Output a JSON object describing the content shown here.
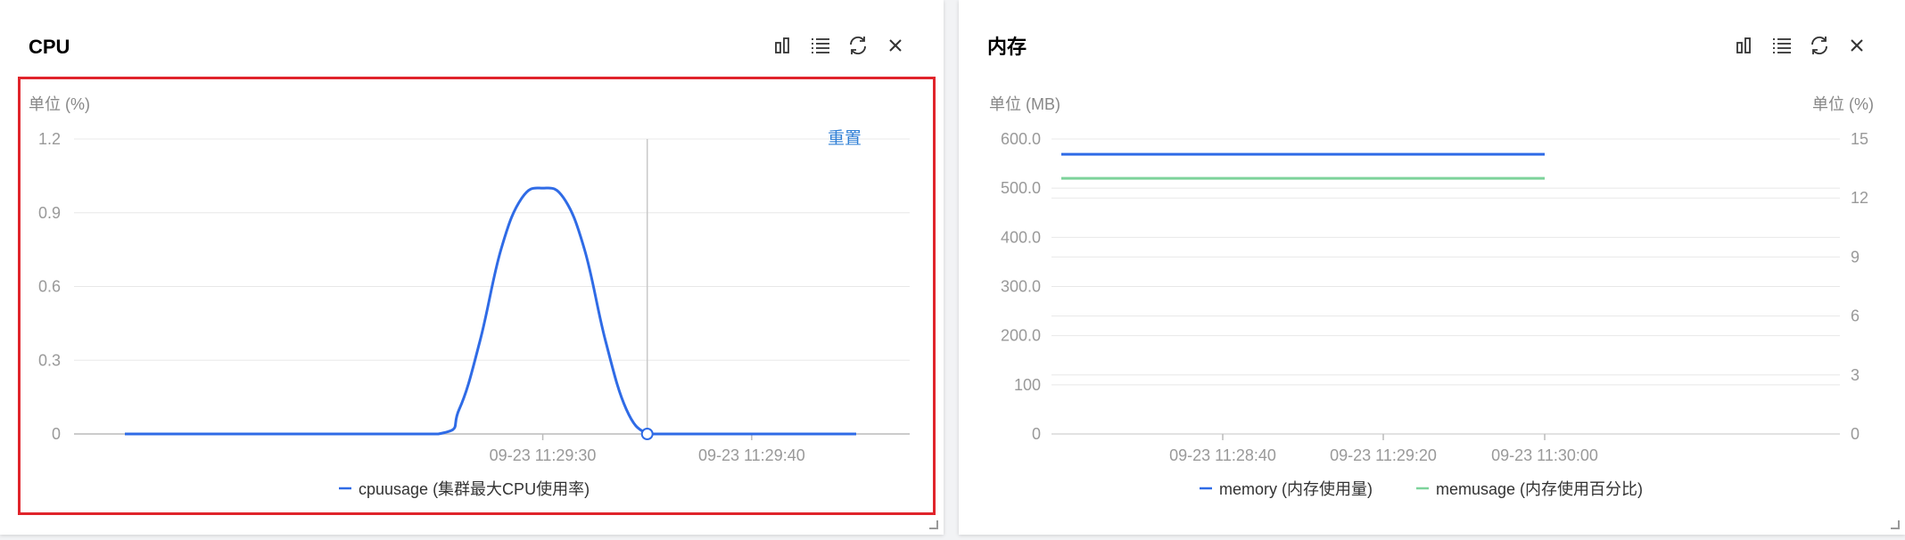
{
  "panels": [
    {
      "id": "cpu",
      "title": "CPU",
      "reset_label": "重置",
      "toolbar_icons": [
        "bar-chart-icon",
        "list-icon",
        "refresh-icon",
        "close-icon"
      ]
    },
    {
      "id": "mem",
      "title": "内存",
      "toolbar_icons": [
        "bar-chart-icon",
        "list-icon",
        "refresh-icon",
        "close-icon"
      ]
    }
  ],
  "colors": {
    "series_blue": "#2f6be6",
    "series_green": "#7dd39b",
    "highlight": "#e0242b",
    "link": "#2f7fd6"
  },
  "chart_data": [
    {
      "type": "line",
      "panel": "cpu",
      "ylabel": "单位 (%)",
      "ylim": [
        0,
        1.2
      ],
      "y_ticks": [
        "0",
        "0.3",
        "0.6",
        "0.9",
        "1.2"
      ],
      "x_tick_labels": [
        "09-23 11:29:30",
        "09-23 11:29:40"
      ],
      "grid": true,
      "legend_position": "bottom",
      "series": [
        {
          "name": "cpuusage (集群最大CPU使用率)",
          "x": [
            0,
            10,
            15,
            16,
            17,
            18,
            19,
            20,
            21,
            22,
            23,
            24,
            25,
            26,
            27,
            35
          ],
          "values": [
            0,
            0,
            0,
            0.1,
            0.38,
            0.75,
            0.96,
            1.0,
            0.96,
            0.75,
            0.38,
            0.1,
            0,
            0,
            0,
            0
          ]
        }
      ],
      "tooltip_marker": {
        "x": 25,
        "y": 0
      }
    },
    {
      "type": "line",
      "panel": "mem",
      "ylabel": "单位 (MB)",
      "ylabel_right": "单位 (%)",
      "ylim": [
        0,
        600
      ],
      "ylim_right": [
        0,
        15
      ],
      "y_ticks": [
        "0",
        "100",
        "200.0",
        "300.0",
        "400.0",
        "500.0",
        "600.0"
      ],
      "y_ticks_right": [
        "0",
        "3",
        "6",
        "9",
        "12",
        "15"
      ],
      "x_tick_labels": [
        "09-23 11:28:40",
        "09-23 11:29:20",
        "09-23 11:30:00"
      ],
      "grid": true,
      "legend_position": "bottom",
      "series": [
        {
          "name": "memory (内存使用量)",
          "axis": "left",
          "values": [
            569,
            569
          ]
        },
        {
          "name": "memusage (内存使用百分比)",
          "axis": "right",
          "values": [
            13,
            13
          ]
        }
      ]
    }
  ]
}
